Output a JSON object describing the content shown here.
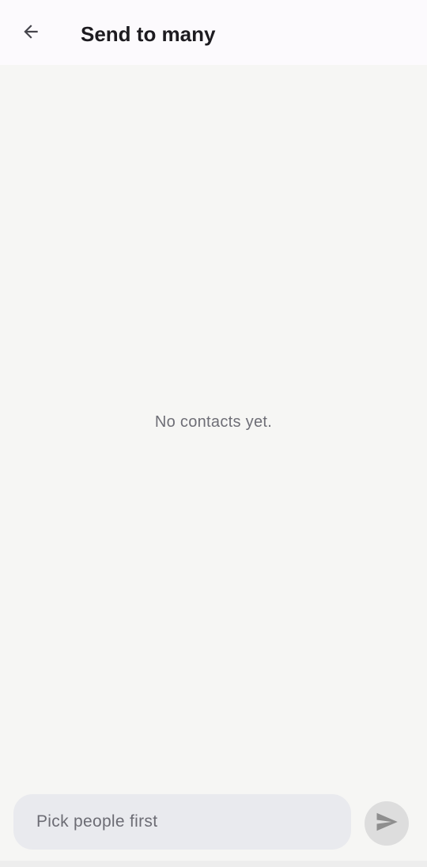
{
  "header": {
    "title": "Send to many",
    "back_icon": "arrow-back-icon"
  },
  "main": {
    "empty_message": "No contacts yet."
  },
  "composer": {
    "placeholder": "Pick people first",
    "value": "",
    "send_icon": "send-icon",
    "send_enabled": false
  },
  "colors": {
    "header_bg": "#fcfafd",
    "body_bg": "#f6f6f4",
    "input_bg": "#e9eaee",
    "send_bg_disabled": "#dddddd",
    "title_text": "#1d1b20",
    "muted_text": "#6e6e76"
  }
}
